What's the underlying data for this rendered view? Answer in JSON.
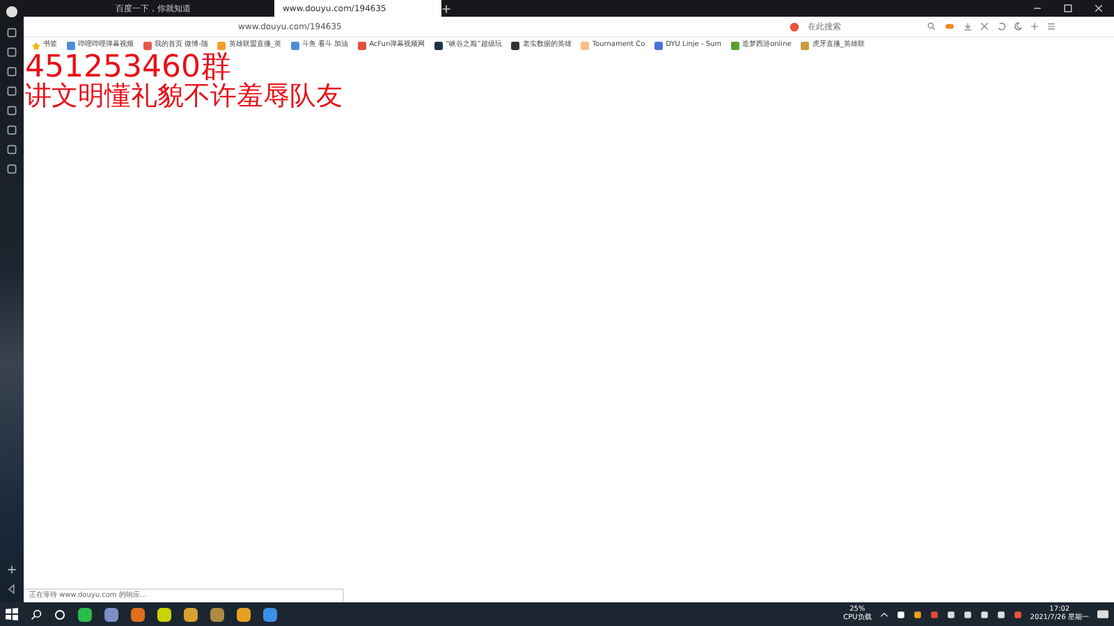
{
  "tabs": [
    {
      "title": "百度一下，你就知道",
      "selected": false
    },
    {
      "title": "www.douyu.com/194635",
      "selected": true
    }
  ],
  "address": "www.douyu.com/194635",
  "search": {
    "placeholder": "在此搜索"
  },
  "bookmarks": [
    {
      "label": "书签"
    },
    {
      "label": "哔哩哔哩弹幕视频"
    },
    {
      "label": "我的首页 微博-随"
    },
    {
      "label": "英雄联盟直播_英"
    },
    {
      "label": "斗鱼 看斗 加油"
    },
    {
      "label": "AcFun弹幕视频网"
    },
    {
      "label": "“峡谷之巅”超级玩"
    },
    {
      "label": "老实数据的英雄"
    },
    {
      "label": "Tournament Co"
    },
    {
      "label": "DYU Linje - Sum"
    },
    {
      "label": "造梦西游online"
    },
    {
      "label": "虎牙直播_英雄联"
    }
  ],
  "overlay": [
    "451253460群",
    "讲文明懂礼貌不许羞辱队友"
  ],
  "status_bar": "正在等待 www.douyu.com 的响应...",
  "taskbar": {
    "cpu": "25%",
    "cpu_label": "CPU负载",
    "time": "17:02",
    "date": "2021/7/26 星期一"
  }
}
